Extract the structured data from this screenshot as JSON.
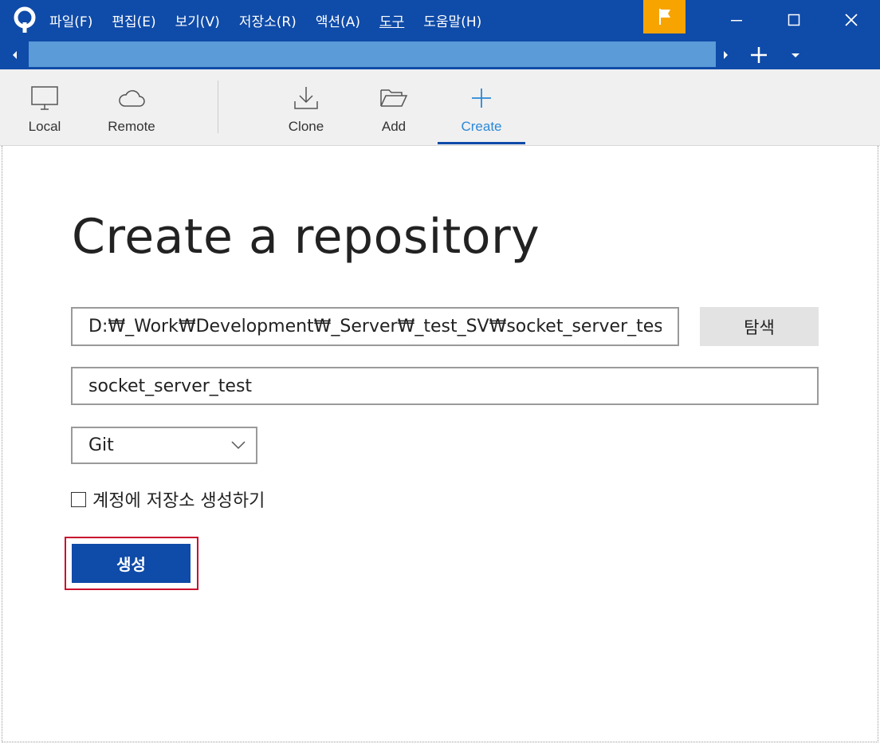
{
  "menu": {
    "items": [
      {
        "label": "파일(F)"
      },
      {
        "label": "편집(E)"
      },
      {
        "label": "보기(V)"
      },
      {
        "label": "저장소(R)"
      },
      {
        "label": "액션(A)"
      },
      {
        "label": "도구"
      },
      {
        "label": "도움말(H)"
      }
    ]
  },
  "toolbar": {
    "local": "Local",
    "remote": "Remote",
    "clone": "Clone",
    "add": "Add",
    "create": "Create",
    "active_tab": "Create"
  },
  "main": {
    "title": "Create a repository",
    "path_value": "D:₩_Work₩Development₩_Server₩_test_SV₩socket_server_test",
    "browse_label": "탐색",
    "name_value": "socket_server_test",
    "vcs_selected": "Git",
    "create_remote_label": "계정에 저장소 생성하기",
    "create_remote_checked": false,
    "create_button_label": "생성"
  },
  "colors": {
    "titlebar": "#0f4ba8",
    "tab_strip": "#5a9bd8",
    "flag": "#f7a400",
    "accent": "#2a88d8",
    "primary_button": "#0f4ba8",
    "highlight": "#c8102e"
  },
  "icons": {
    "app": "sourcetree-logo-icon",
    "flag": "flag-icon",
    "local": "monitor-icon",
    "remote": "cloud-icon",
    "clone": "download-icon",
    "add": "folder-open-icon",
    "create": "plus-icon"
  }
}
